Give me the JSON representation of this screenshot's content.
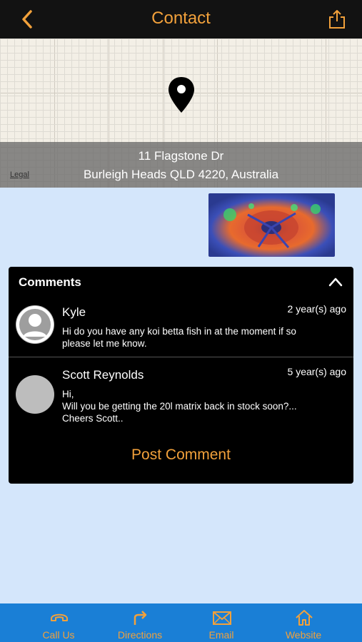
{
  "header": {
    "title": "Contact"
  },
  "map": {
    "address_line1": "11 Flagstone Dr",
    "address_line2": "Burleigh Heads QLD 4220, Australia",
    "legal": "Legal"
  },
  "comments": {
    "title": "Comments",
    "items": [
      {
        "name": "Kyle",
        "time": "2 year(s) ago",
        "text": "Hi do you have any koi betta fish in at the moment if so please let me know."
      },
      {
        "name": "Scott Reynolds",
        "time": "5 year(s) ago",
        "text_lines": [
          "Hi,",
          "Will you be getting the 20l matrix back in stock soon?...",
          "Cheers Scott.."
        ]
      }
    ],
    "post_label": "Post Comment"
  },
  "tabbar": {
    "items": [
      {
        "label": "Call Us",
        "icon": "phone-icon"
      },
      {
        "label": "Directions",
        "icon": "directions-icon"
      },
      {
        "label": "Email",
        "icon": "email-icon"
      },
      {
        "label": "Website",
        "icon": "home-icon"
      }
    ]
  },
  "colors": {
    "accent": "#f2a13b",
    "header_bg": "#121212",
    "tabbar_bg": "#1a7fd6",
    "page_bg": "#d4e6fb"
  }
}
